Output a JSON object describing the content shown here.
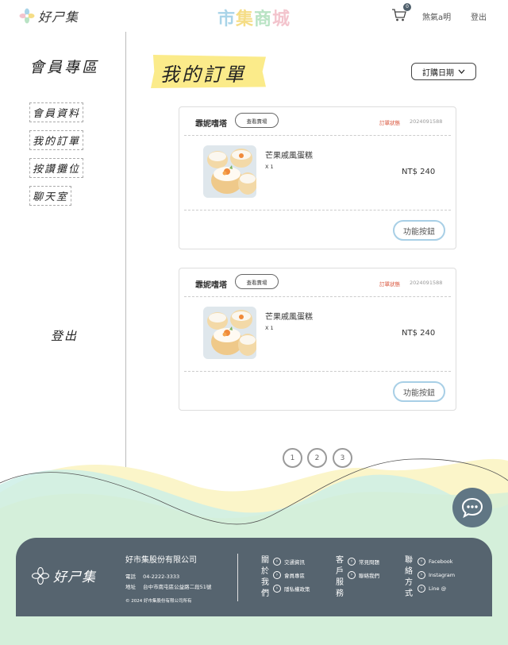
{
  "header": {
    "logo_text": "好ㄕ集",
    "brand_title": [
      "市",
      "集",
      "商",
      "城"
    ],
    "brand_colors": [
      "#a9d4e8",
      "#f5dd86",
      "#b9e3c4",
      "#f3c4cd"
    ],
    "cart_count": "0",
    "user_name": "煞氣a明",
    "logout_label": "登出"
  },
  "sidebar": {
    "title": "會員專區",
    "items": [
      {
        "label": "會員資料"
      },
      {
        "label": "我的訂單"
      },
      {
        "label": "按讚攤位"
      },
      {
        "label": "聊天室"
      }
    ],
    "logout_label": "登出"
  },
  "main": {
    "page_title": "我的訂單",
    "sort_label": "訂購日期",
    "orders": [
      {
        "shop": "霏妮嗜塔",
        "view_shop_label": "查看賣場",
        "status": "訂單狀態",
        "order_id": "2024091588",
        "product": "芒果戚風蛋糕",
        "qty": "X 1",
        "price": "NT$ 240",
        "function_label": "功能按鈕"
      },
      {
        "shop": "霏妮嗜塔",
        "view_shop_label": "查看賣場",
        "status": "訂單狀態",
        "order_id": "2024091588",
        "product": "芒果戚風蛋糕",
        "qty": "X 1",
        "price": "NT$ 240",
        "function_label": "功能按鈕"
      }
    ],
    "pagination": [
      "1",
      "2",
      "3"
    ]
  },
  "footer": {
    "logo_text": "好ㄕ集",
    "company": "好市集股份有限公司",
    "phone_label": "電話",
    "phone": "04-2222-3333",
    "address_label": "地址",
    "address": "台中市南屯區公益路二段51號",
    "copyright": "© 2024 好市集股份有限公司所有",
    "columns": [
      {
        "head": [
          "關",
          "於",
          "我",
          "們"
        ],
        "links": [
          "交通資訊",
          "會員專區",
          "隱私權政策"
        ]
      },
      {
        "head": [
          "客",
          "戶",
          "服",
          "務"
        ],
        "links": [
          "常見問題",
          "聯絡我們"
        ]
      },
      {
        "head": [
          "聯",
          "絡",
          "方",
          "式"
        ],
        "links": [
          "Facebook",
          "Instagram",
          "Line @"
        ]
      }
    ]
  },
  "colors": {
    "accent_dark": "#56646f",
    "title_highlight": "#fbeb8a",
    "status_red": "#d9533a",
    "button_border": "#a8cfe6"
  }
}
